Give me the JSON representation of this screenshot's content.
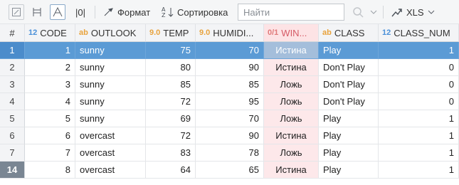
{
  "toolbar": {
    "format_label": "Формат",
    "sort_label": "Сортировка",
    "search_placeholder": "Найти",
    "export_label": "XLS",
    "text_toggle_label": "|0|"
  },
  "columns": [
    {
      "type": "#",
      "name": "",
      "kind": "hash"
    },
    {
      "type": "12",
      "name": "CODE",
      "kind": "num"
    },
    {
      "type": "ab",
      "name": "OUTLOOK",
      "kind": "str"
    },
    {
      "type": "9.0",
      "name": "TEMP",
      "kind": "dec"
    },
    {
      "type": "9.0",
      "name": "HUMIDI...",
      "kind": "dec"
    },
    {
      "type": "0/1",
      "name": "WIN...",
      "kind": "bool"
    },
    {
      "type": "ab",
      "name": "CLASS",
      "kind": "str"
    },
    {
      "type": "12",
      "name": "CLASS_NUM",
      "kind": "num"
    }
  ],
  "rows": [
    {
      "idx": "1",
      "code": "1",
      "outlook": "sunny",
      "temp": "75",
      "humidity": "70",
      "windy": "Истина",
      "class": "Play",
      "class_num": "1"
    },
    {
      "idx": "2",
      "code": "2",
      "outlook": "sunny",
      "temp": "80",
      "humidity": "90",
      "windy": "Истина",
      "class": "Don't Play",
      "class_num": "0"
    },
    {
      "idx": "3",
      "code": "3",
      "outlook": "sunny",
      "temp": "85",
      "humidity": "85",
      "windy": "Ложь",
      "class": "Don't Play",
      "class_num": "0"
    },
    {
      "idx": "4",
      "code": "4",
      "outlook": "sunny",
      "temp": "72",
      "humidity": "95",
      "windy": "Ложь",
      "class": "Don't Play",
      "class_num": "0"
    },
    {
      "idx": "5",
      "code": "5",
      "outlook": "sunny",
      "temp": "69",
      "humidity": "70",
      "windy": "Ложь",
      "class": "Play",
      "class_num": "1"
    },
    {
      "idx": "6",
      "code": "6",
      "outlook": "overcast",
      "temp": "72",
      "humidity": "90",
      "windy": "Истина",
      "class": "Play",
      "class_num": "1"
    },
    {
      "idx": "7",
      "code": "7",
      "outlook": "overcast",
      "temp": "83",
      "humidity": "78",
      "windy": "Ложь",
      "class": "Play",
      "class_num": "1"
    },
    {
      "idx": "14",
      "code": "8",
      "outlook": "overcast",
      "temp": "64",
      "humidity": "65",
      "windy": "Истина",
      "class": "Play",
      "class_num": "1"
    }
  ]
}
